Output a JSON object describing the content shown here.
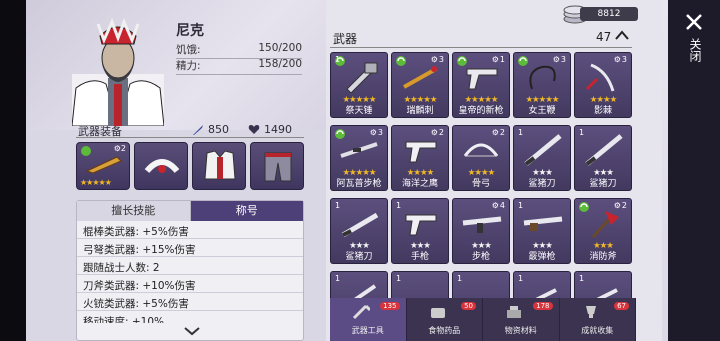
{
  "character": {
    "name": "尼克",
    "hunger_label": "饥饿:",
    "hunger_value": "150/200",
    "energy_label": "精力:",
    "energy_value": "158/200"
  },
  "equipment": {
    "title": "武器装备",
    "attack": "850",
    "health": "1490",
    "slot1_count": "2"
  },
  "skills": {
    "tabs": [
      "擅长技能",
      "称号"
    ],
    "rows": [
      "棍棒类武器: +5%伤害",
      "弓弩类武器: +15%伤害",
      "跟随战士人数: 2",
      "刀斧类武器: +10%伤害",
      "火铳类武器: +5%伤害",
      "移动速度: +10%"
    ]
  },
  "currency": {
    "amount": "8812"
  },
  "weapons": {
    "title": "武器",
    "count": "47",
    "items": [
      {
        "name": "祭天锤",
        "count": "1",
        "stars": 5,
        "gold": true,
        "gear": false,
        "recycle": true
      },
      {
        "name": "瑞麟刺",
        "count": "3",
        "stars": 5,
        "gold": true,
        "gear": true,
        "recycle": true
      },
      {
        "name": "皇帝的新枪",
        "count": "1",
        "stars": 5,
        "gold": true,
        "gear": true,
        "recycle": true
      },
      {
        "name": "女王鞭",
        "count": "3",
        "stars": 5,
        "gold": true,
        "gear": true,
        "recycle": true
      },
      {
        "name": "影棘",
        "count": "3",
        "stars": 4,
        "gold": true,
        "gear": true,
        "recycle": false
      },
      {
        "name": "阿瓦普步枪",
        "count": "3",
        "stars": 5,
        "gold": true,
        "gear": true,
        "recycle": true
      },
      {
        "name": "海洋之鹰",
        "count": "2",
        "stars": 4,
        "gold": true,
        "gear": true,
        "recycle": false
      },
      {
        "name": "骨弓",
        "count": "2",
        "stars": 4,
        "gold": true,
        "gear": true,
        "recycle": false
      },
      {
        "name": "鲨猪刀",
        "count": "1",
        "stars": 3,
        "gold": false,
        "gear": false,
        "recycle": false
      },
      {
        "name": "鲨猪刀",
        "count": "1",
        "stars": 3,
        "gold": false,
        "gear": false,
        "recycle": false
      },
      {
        "name": "鲨猪刀",
        "count": "1",
        "stars": 3,
        "gold": false,
        "gear": false,
        "recycle": false
      },
      {
        "name": "手枪",
        "count": "1",
        "stars": 3,
        "gold": false,
        "gear": false,
        "recycle": false
      },
      {
        "name": "步枪",
        "count": "4",
        "stars": 3,
        "gold": false,
        "gear": true,
        "recycle": false
      },
      {
        "name": "霰弹枪",
        "count": "1",
        "stars": 3,
        "gold": false,
        "gear": false,
        "recycle": false
      },
      {
        "name": "消防斧",
        "count": "2",
        "stars": 3,
        "gold": true,
        "gear": true,
        "recycle": true
      },
      {
        "name": "",
        "count": "1",
        "stars": 0,
        "gold": false,
        "gear": false,
        "recycle": false
      },
      {
        "name": "",
        "count": "1",
        "stars": 0,
        "gold": false,
        "gear": false,
        "recycle": false
      },
      {
        "name": "",
        "count": "1",
        "stars": 0,
        "gold": false,
        "gear": false,
        "recycle": false
      },
      {
        "name": "",
        "count": "1",
        "stars": 0,
        "gold": false,
        "gear": false,
        "recycle": false
      },
      {
        "name": "",
        "count": "1",
        "stars": 0,
        "gold": false,
        "gear": false,
        "recycle": false
      }
    ]
  },
  "bottom_tabs": [
    {
      "label": "武器工具",
      "badge": "135",
      "icon": "weapon-tools-icon",
      "active": true
    },
    {
      "label": "食物药品",
      "badge": "50",
      "icon": "food-icon",
      "active": false
    },
    {
      "label": "物资材料",
      "badge": "178",
      "icon": "materials-icon",
      "active": false
    },
    {
      "label": "成就收集",
      "badge": "67",
      "icon": "trophy-icon",
      "active": false
    }
  ],
  "close": {
    "label": "关闭"
  },
  "colors": {
    "accent": "#4d3f78",
    "star_gold": "#f2b826",
    "badge_red": "#d8343c"
  }
}
